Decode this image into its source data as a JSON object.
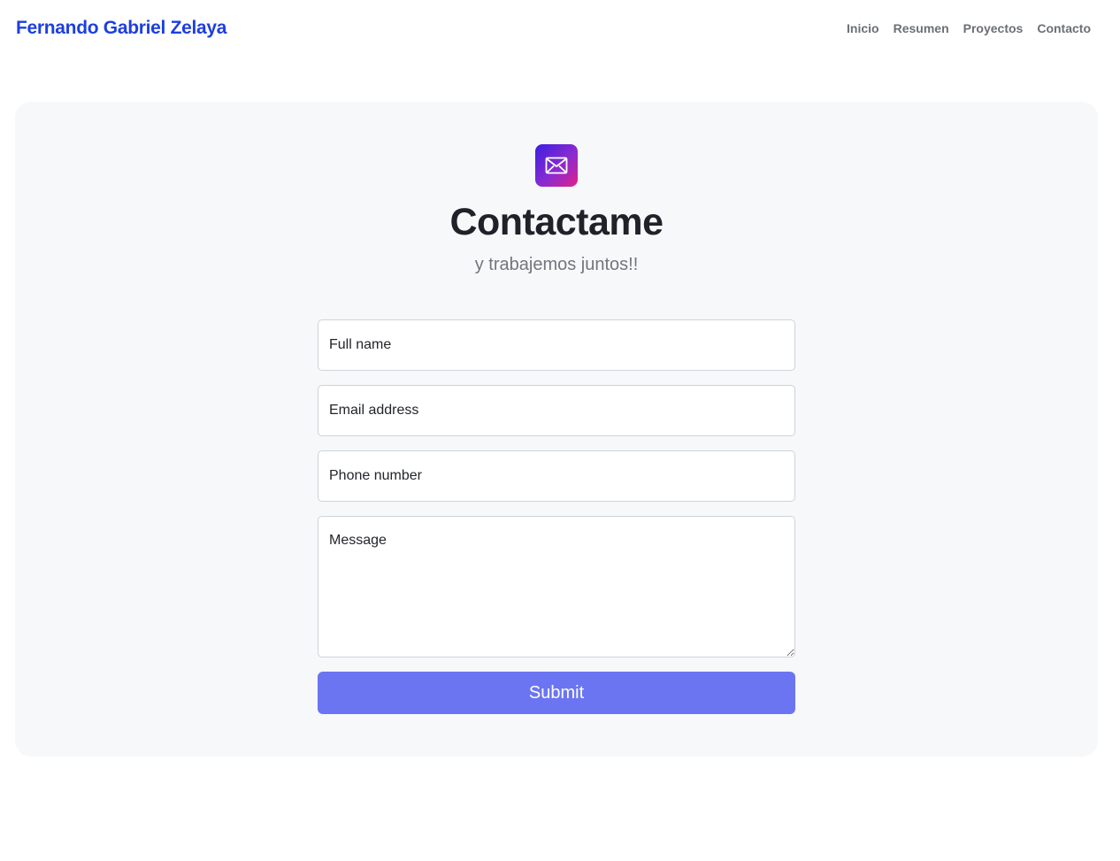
{
  "header": {
    "brand": "Fernando Gabriel Zelaya",
    "nav": [
      {
        "label": "Inicio"
      },
      {
        "label": "Resumen"
      },
      {
        "label": "Proyectos"
      },
      {
        "label": "Contacto"
      }
    ]
  },
  "contact": {
    "icon": "envelope-icon",
    "title": "Contactame",
    "subtitle": "y trabajemos juntos!!",
    "form": {
      "full_name": {
        "placeholder": "Full name",
        "value": ""
      },
      "email": {
        "placeholder": "Email address",
        "value": ""
      },
      "phone": {
        "placeholder": "Phone number",
        "value": ""
      },
      "message": {
        "placeholder": "Message",
        "value": ""
      },
      "submit_label": "Submit"
    }
  },
  "colors": {
    "brand": "#1d3fe0",
    "nav_text": "#6b6f76",
    "card_bg": "#f7f8fa",
    "submit_bg": "#6b75f2",
    "icon_gradient_start": "#3d1fe0",
    "icon_gradient_end": "#e0208a"
  }
}
